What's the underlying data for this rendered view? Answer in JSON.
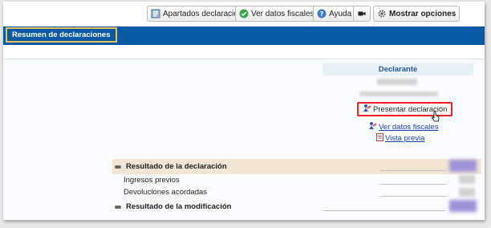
{
  "toolbar": {
    "apartados": {
      "label": "Apartados declaración",
      "icon": "document-list-icon"
    },
    "ver_datos": {
      "label": "Ver datos fiscales",
      "icon": "green-check-icon"
    },
    "ayuda": {
      "label": "Ayuda",
      "icon": "help-icon"
    },
    "video": {
      "icon": "video-camera-icon"
    },
    "mostrar": {
      "label": "Mostrar opciones",
      "icon": "options-gear-icon"
    }
  },
  "tab": {
    "label": "Resumen de declaraciones"
  },
  "declarante": {
    "heading": "Declarante",
    "present_label": "Presentar declaración",
    "ver_datos_label": "Ver datos fiscales",
    "vista_previa_label": "Vista previa"
  },
  "resultado": {
    "title": "Resultado de la declaración",
    "rows": [
      {
        "label": "Ingresos previos"
      },
      {
        "label": "Devoluciones acordadas"
      }
    ],
    "modificacion_title": "Resultado de la modificación"
  },
  "colors": {
    "accent": "#0a5aa6",
    "highlight": "#e22222",
    "tab_border": "#e5c156"
  }
}
